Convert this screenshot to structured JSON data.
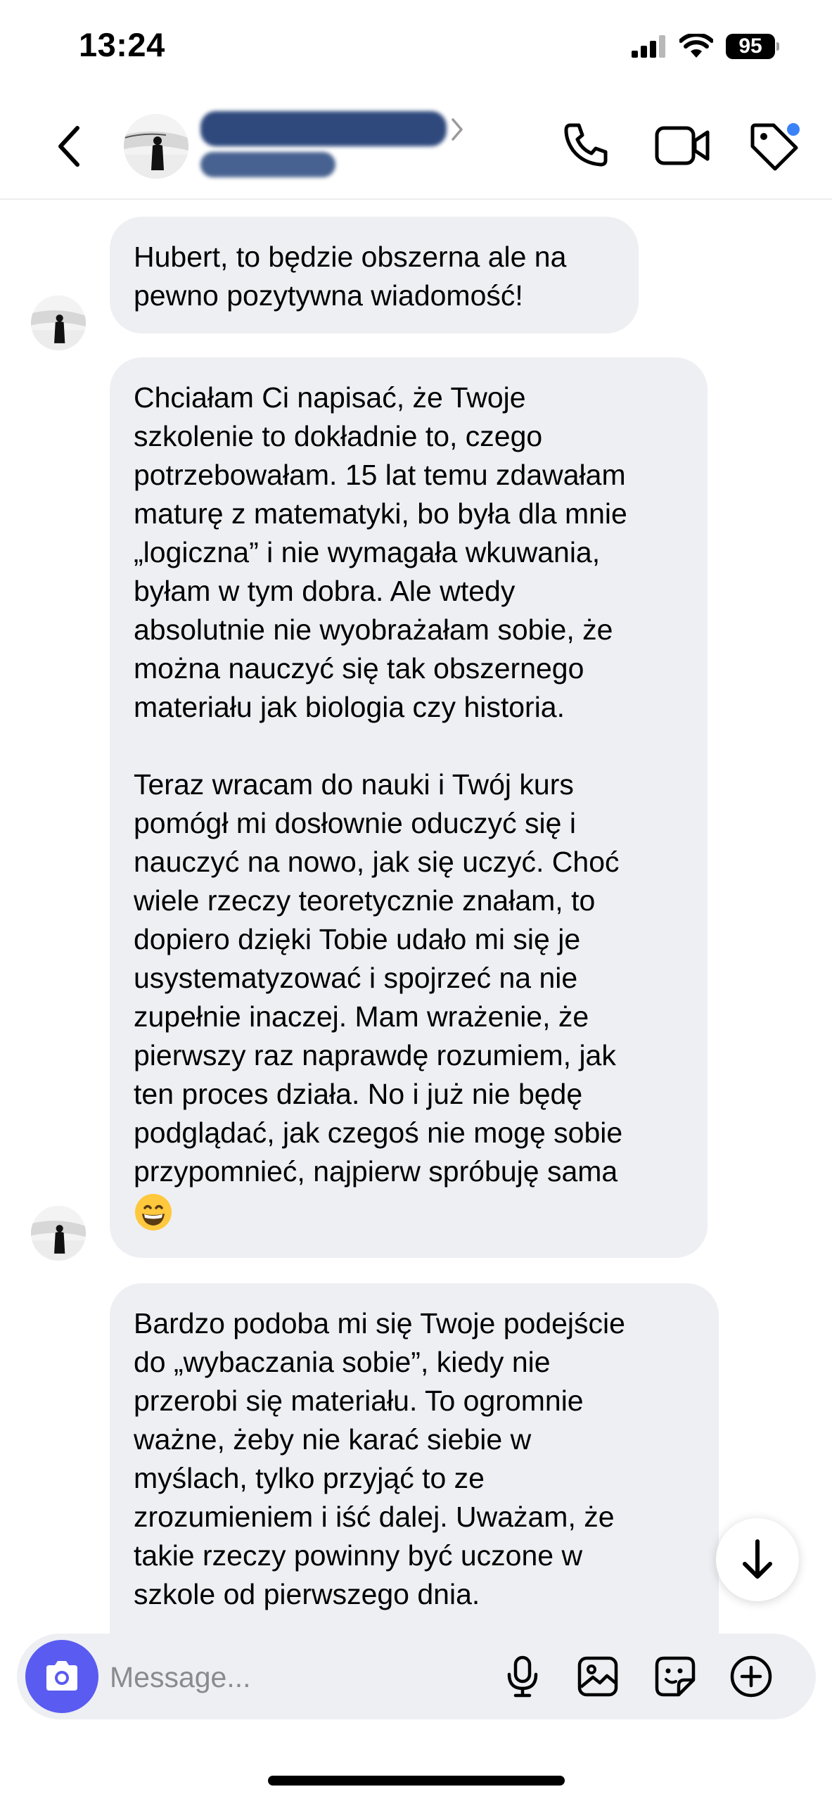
{
  "status_bar": {
    "time": "13:24",
    "battery": "95"
  },
  "header": {
    "contact_name": "",
    "contact_subtitle": "",
    "notification_dot_color": "#3b82f6"
  },
  "messages": [
    {
      "text": "Hubert, to będzie obszerna ale na\npewno pozytywna wiadomość!"
    },
    {
      "text": "Chciałam Ci napisać, że Twoje\nszkolenie to dokładnie to, czego\npotrzebowałam. 15 lat temu zdawałam\nmaturę z matematyki, bo była dla mnie\n„logiczna” i nie wymagała wkuwania,\nbyłam w tym dobra. Ale wtedy\nabsolutnie nie wyobrażałam sobie, że\nmożna nauczyć się tak obszernego\nmateriału jak biologia czy historia.\n\nTeraz wracam do nauki i Twój kurs\npomógł mi dosłownie oduczyć się i\nnauczyć na nowo, jak się uczyć. Choć\nwiele rzeczy teoretycznie znałam, to\ndopiero dzięki Tobie udało mi się je\nusystematyzować i spojrzeć na nie\nzupełnie inaczej. Mam wrażenie, że\npierwszy raz naprawdę rozumiem, jak\nten proces działa. No i już nie będę\npodglądać, jak czegoś nie mogę sobie\nprzypomnieć, najpierw spróbuję sama",
      "emoji": "grinning-face-emoji"
    },
    {
      "text": "Bardzo podoba mi się Twoje podejście\ndo „wybaczania sobie”, kiedy nie\nprzerobi się materiału. To ogromnie\nważne, żeby nie karać siebie w\nmyślach, tylko przyjąć to ze\nzrozumieniem i iść dalej. Uważam, że\ntakie rzeczy powinny być uczone w\nszkole od pierwszego dnia."
    }
  ],
  "composer": {
    "placeholder": "Message...",
    "accent_color": "#5a5bf0"
  }
}
